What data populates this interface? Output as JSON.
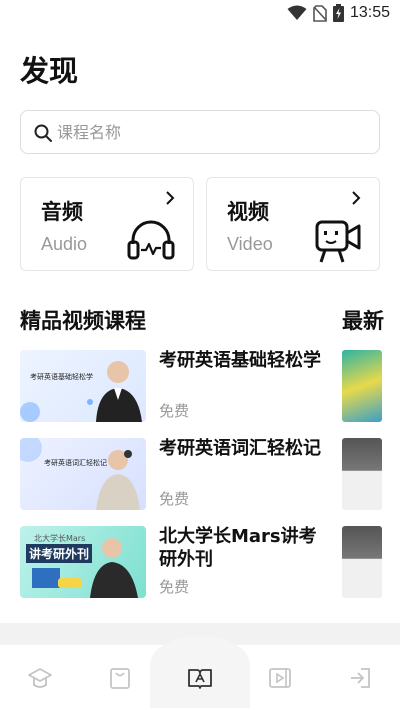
{
  "status_bar": {
    "time": "13:55",
    "icons": [
      "wifi-icon",
      "no-sim-icon",
      "battery-icon"
    ]
  },
  "page_title": "发现",
  "search": {
    "placeholder": "课程名称",
    "value": ""
  },
  "categories": [
    {
      "title": "音频",
      "subtitle": "Audio",
      "icon": "headphones-icon"
    },
    {
      "title": "视频",
      "subtitle": "Video",
      "icon": "video-camera-icon"
    }
  ],
  "sections": {
    "featured": "精品视频课程",
    "latest": "最新"
  },
  "courses": [
    {
      "title": "考研英语基础轻松学",
      "price": "免费",
      "thumb_text": "考研英语基础轻松学"
    },
    {
      "title": "考研英语词汇轻松记",
      "price": "免费",
      "thumb_text": "考研英语词汇轻松记"
    },
    {
      "title": "北大学长Mars讲考研外刊",
      "price": "免费",
      "thumb_text": "北大学长Mars",
      "thumb_text2": "讲考研外刊"
    }
  ],
  "tabbar": {
    "icons": [
      "graduation-cap-icon",
      "bag-icon",
      "open-book-icon",
      "video-play-icon",
      "exit-icon"
    ],
    "active_index": 2
  },
  "colors": {
    "text": "#111111",
    "muted": "#999999",
    "border": "#e6e6e6",
    "tab_icon": "#c4c4c4",
    "tab_active": "#333333"
  }
}
